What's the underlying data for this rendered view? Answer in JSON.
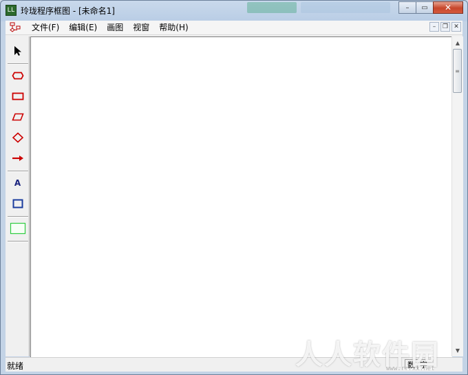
{
  "window": {
    "app_icon_text": "LL",
    "title": "玲珑程序框图 - [未命名1]",
    "caption": {
      "minimize": "–",
      "restore": "▭",
      "close": "✕"
    },
    "blurred_background_colors": [
      "#2f9e6e",
      "#9fbdd9"
    ]
  },
  "menubar": {
    "items": [
      {
        "label": "文件(F)"
      },
      {
        "label": "编辑(E)"
      },
      {
        "label": "画图"
      },
      {
        "label": "视窗"
      },
      {
        "label": "帮助(H)"
      }
    ],
    "mdi": {
      "minimize": "–",
      "restore": "❐",
      "close": "✕"
    }
  },
  "toolbar": {
    "tools": [
      {
        "name": "pointer",
        "icon": "pointer-arrow-icon"
      },
      {
        "name": "terminal",
        "icon": "terminal-shape-icon"
      },
      {
        "name": "process",
        "icon": "process-rectangle-icon"
      },
      {
        "name": "io",
        "icon": "parallelogram-icon"
      },
      {
        "name": "decision",
        "icon": "diamond-icon"
      },
      {
        "name": "arrow",
        "icon": "arrow-icon"
      },
      {
        "name": "text",
        "icon": "text-icon",
        "label": "A"
      },
      {
        "name": "box",
        "icon": "blue-rectangle-icon"
      },
      {
        "name": "frame",
        "icon": "green-rectangle-icon"
      }
    ],
    "colors": {
      "shape": "#cc0000",
      "text": "#1a237e",
      "box": "#1a3c9e",
      "frame": "#2ecc40"
    }
  },
  "scrollbar": {
    "up": "▲",
    "down": "▼",
    "grip": "≡"
  },
  "status": {
    "text": "就绪",
    "cells": [
      "数",
      "字"
    ]
  },
  "watermark": {
    "text": "人人软件园",
    "sub": "www.rrrxx.net"
  }
}
